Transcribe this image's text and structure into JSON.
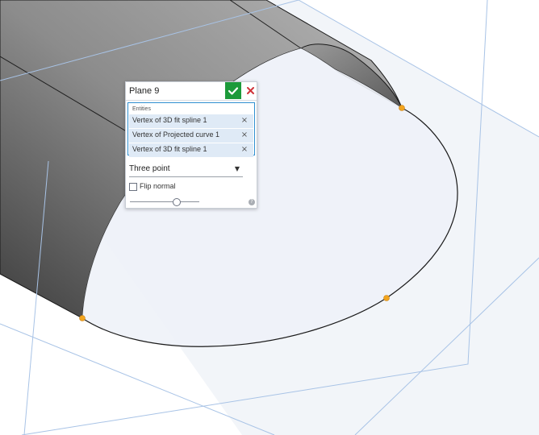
{
  "panel": {
    "feature_name": "Plane 9",
    "entities_label": "Entities",
    "entities": [
      "Vertex of 3D fit spline 1",
      "Vertex of Projected curve 1",
      "Vertex of 3D fit spline 1"
    ],
    "remove_symbol": "×",
    "plane_type": "Three point",
    "flip_normal_label": "Flip normal",
    "flip_normal_checked": false,
    "slider_fraction": 0.68,
    "help_symbol": "?"
  },
  "colors": {
    "accept": "#1c9a3a",
    "cancel": "#d0343a",
    "selection_border": "#2e8fd1",
    "vertex_point": "#f2a51f",
    "plane_edge": "#a8c3e6"
  }
}
